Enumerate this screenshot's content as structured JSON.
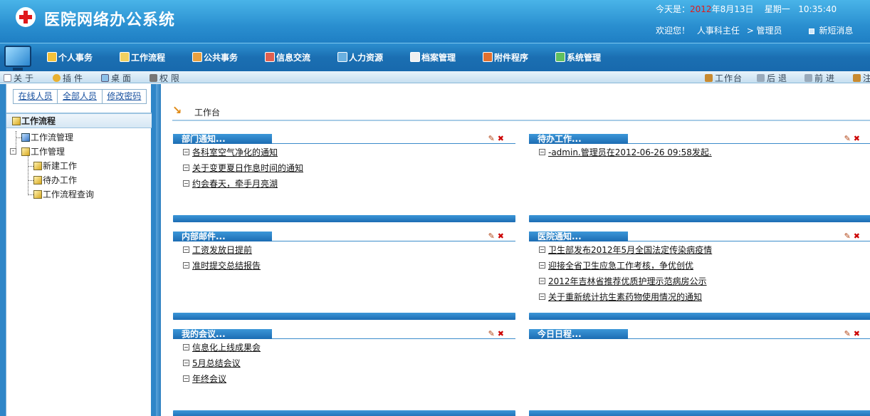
{
  "header": {
    "title": "医院网络办公系统",
    "date_prefix": "今天是：",
    "date_year": "2012",
    "date_rest": "年8月13日",
    "weekday": "星期一",
    "time": "10:35:40",
    "welcome": "欢迎您！",
    "user_role": "人事科主任",
    "user_group": "> 管理员",
    "new_message": "新短消息"
  },
  "nav": {
    "items": [
      "个人事务",
      "工作流程",
      "公共事务",
      "信息交流",
      "人力资源",
      "档案管理",
      "附件程序",
      "系统管理"
    ]
  },
  "subbar": {
    "left": [
      "关于",
      "插件",
      "桌面",
      "权限"
    ],
    "right": [
      "工作台",
      "后退",
      "前进",
      "注"
    ]
  },
  "sidebar": {
    "tabs": [
      "在线人员",
      "全部人员",
      "修改密码"
    ],
    "section": "工作流程",
    "tree": {
      "manage": "工作流管理",
      "work": "工作管理",
      "new_work": "新建工作",
      "todo": "待办工作",
      "query": "工作流程查询"
    }
  },
  "main": {
    "breadcrumb": "工作台",
    "panels": [
      {
        "title": "部门通知...",
        "items": [
          "各科室空气净化的通知",
          "关于变更夏日作息时间的通知",
          "约会春天，牵手月亮湖"
        ]
      },
      {
        "title": "待办工作...",
        "items": [
          "-admin.管理员在2012-06-26 09:58发起."
        ]
      },
      {
        "title": "内部邮件...",
        "items": [
          "工资发放日提前",
          "准时提交总结报告"
        ]
      },
      {
        "title": "医院通知...",
        "items": [
          "卫生部发布2012年5月全国法定传染病疫情",
          "迎接全省卫生应急工作考核，争优创优",
          "2012年吉林省推荐优质护理示范病房公示",
          "关于重新统计抗生素药物使用情况的通知"
        ]
      },
      {
        "title": "我的会议...",
        "items": [
          "信息化上线成果会",
          "5月总结会议",
          "年终会议"
        ]
      },
      {
        "title": "今日日程...",
        "items": []
      }
    ]
  }
}
